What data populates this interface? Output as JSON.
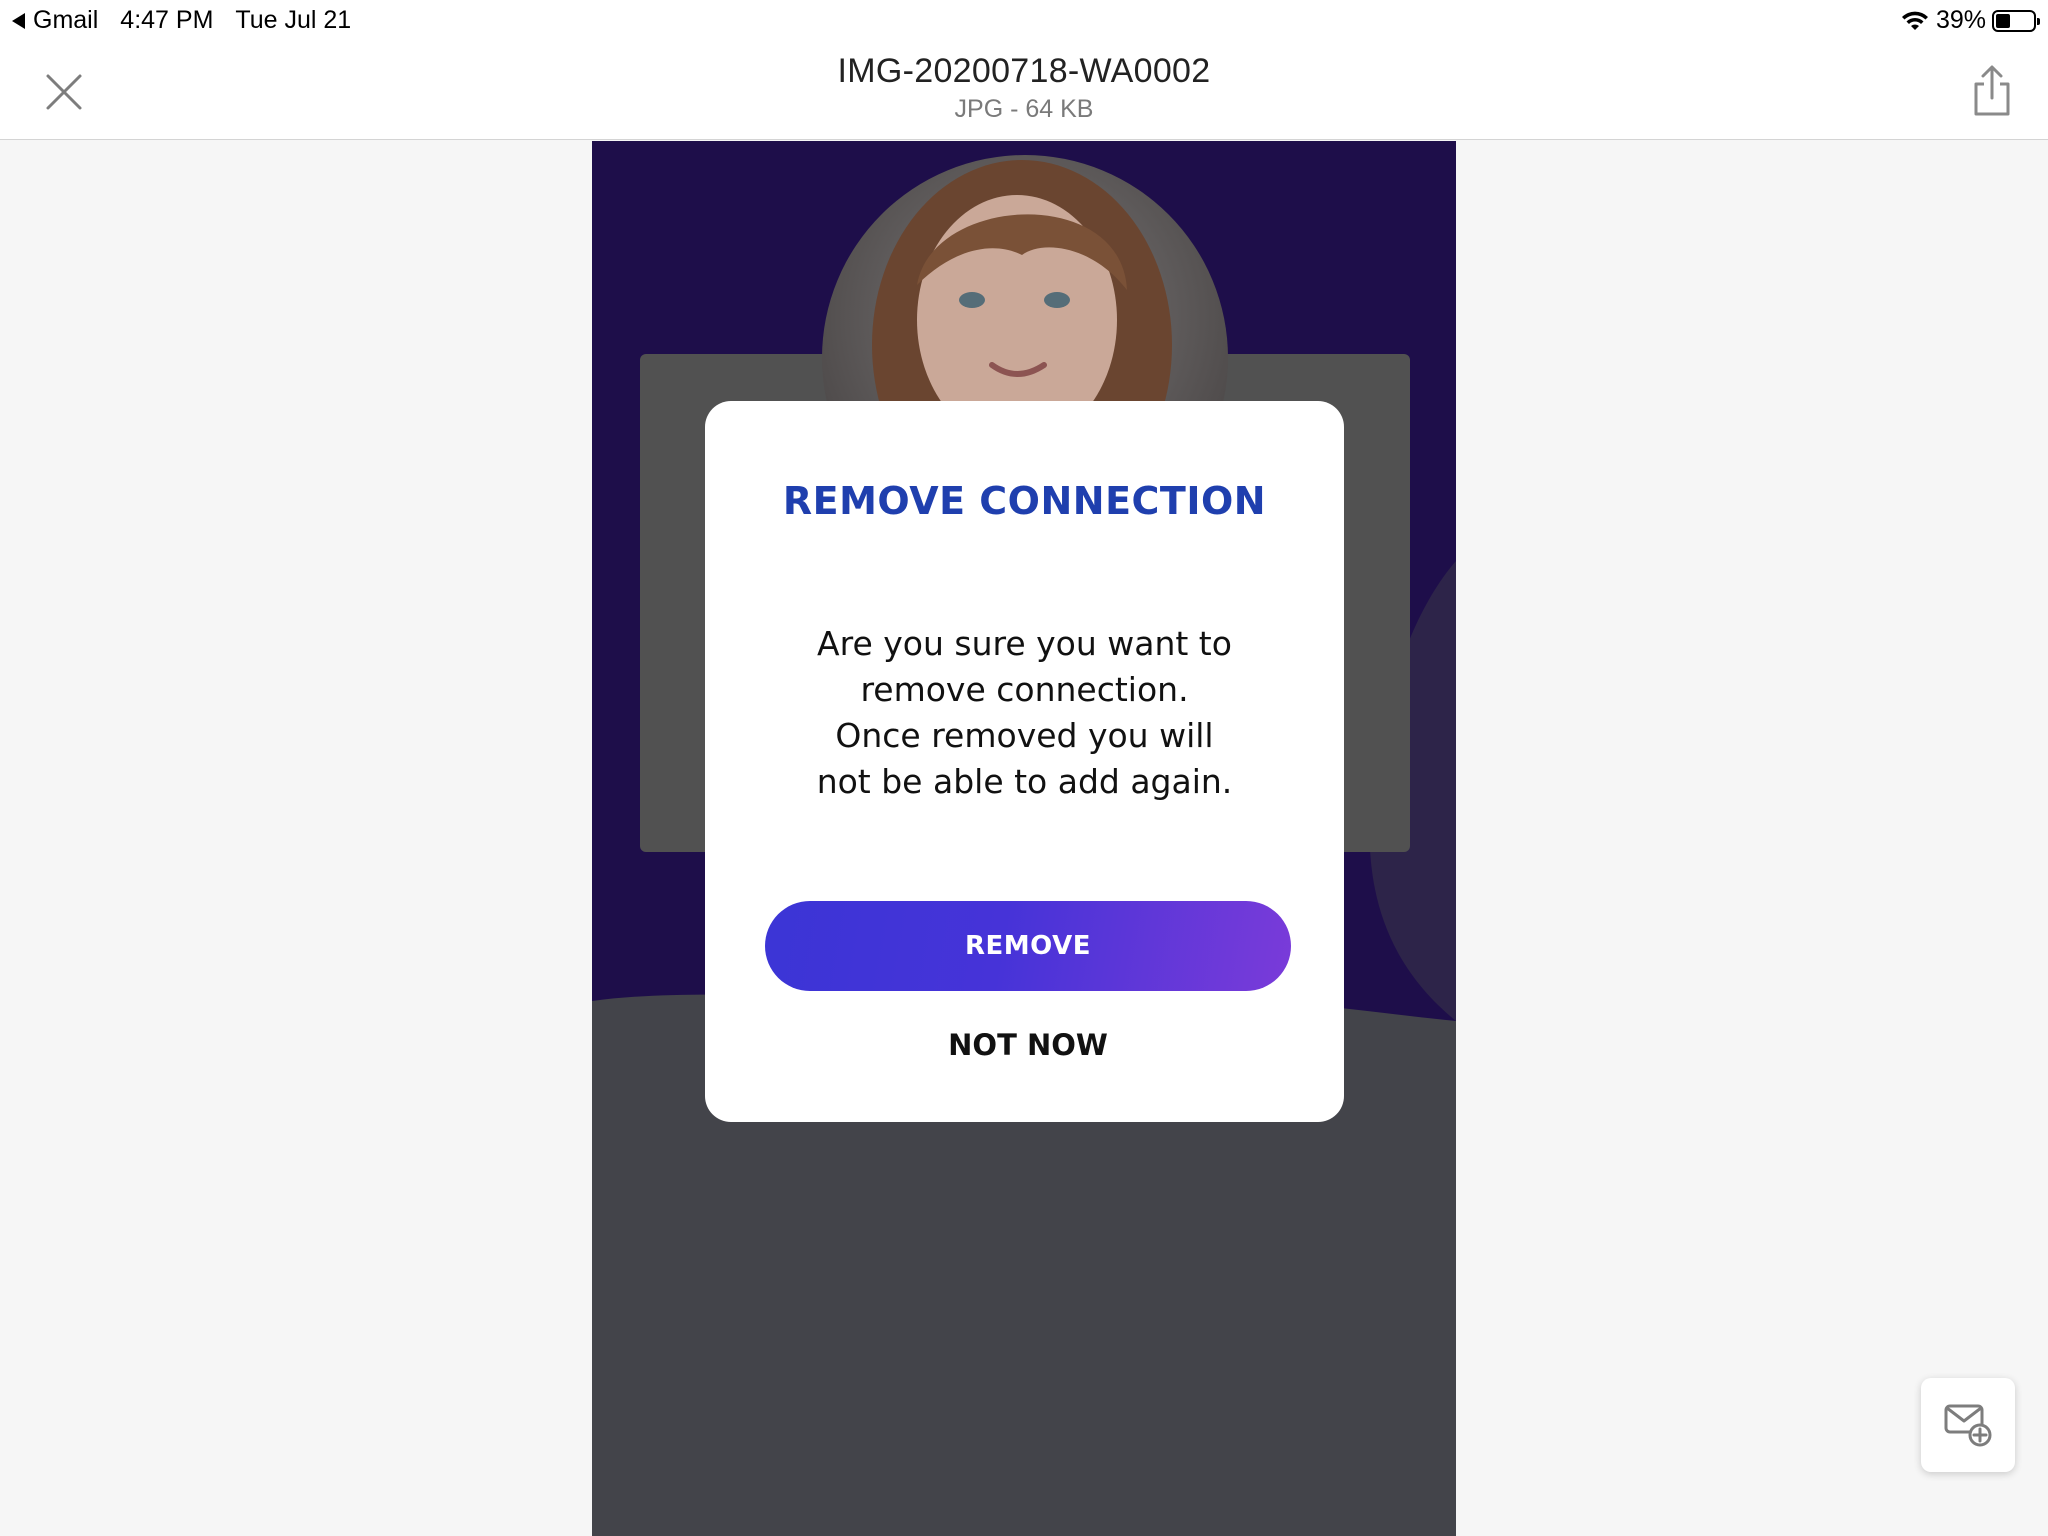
{
  "status_bar": {
    "back_app": "Gmail",
    "time": "4:47 PM",
    "date": "Tue Jul 21",
    "battery_percent": "39%",
    "battery_level": 0.39
  },
  "header": {
    "title": "IMG-20200718-WA0002",
    "subtitle": "JPG - 64 KB",
    "close_icon": "close-icon",
    "share_icon": "share-icon"
  },
  "dialog": {
    "title": "REMOVE CONNECTION",
    "message_lines": [
      "Are you sure you want to",
      "remove connection.",
      "Once removed you will",
      "not be able to add again."
    ],
    "primary_button": "REMOVE",
    "secondary_button": "NOT NOW"
  },
  "fab": {
    "icon": "compose-mail-icon"
  },
  "colors": {
    "dialog_title": "#1f3fae",
    "button_gradient_start": "#3b35d6",
    "button_gradient_end": "#7a3bd9",
    "image_purple": "#1e0e4a",
    "image_dark": "#43444a"
  }
}
